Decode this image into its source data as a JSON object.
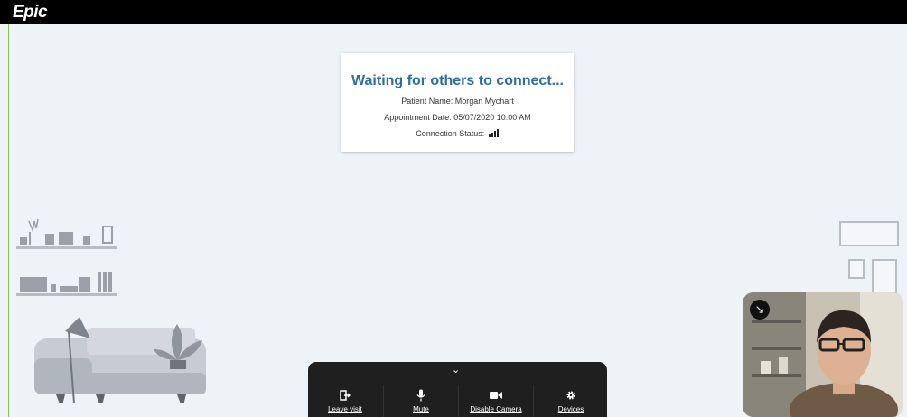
{
  "header": {
    "logo_text": "Epic"
  },
  "waiting_card": {
    "title": "Waiting for others to connect...",
    "patient_name": "Patient Name: Morgan Mychart",
    "appointment_date": "Appointment Date: 05/07/2020 10:00 AM",
    "connection_status": "Connection Status:"
  },
  "controls": {
    "expand_icon": "chevron-down-icon",
    "buttons": [
      {
        "label": "Leave visit",
        "icon": "leave-icon"
      },
      {
        "label": "Mute",
        "icon": "microphone-icon"
      },
      {
        "label": "Disable Camera",
        "icon": "camera-icon"
      },
      {
        "label": "Devices",
        "icon": "gear-icon"
      }
    ]
  },
  "self_view": {
    "minimize_icon": "minimize-arrow-icon"
  },
  "colors": {
    "accent": "#2e6da4",
    "topbar": "#000000",
    "background": "#eef3f8",
    "controls": "#1f1f1f"
  }
}
